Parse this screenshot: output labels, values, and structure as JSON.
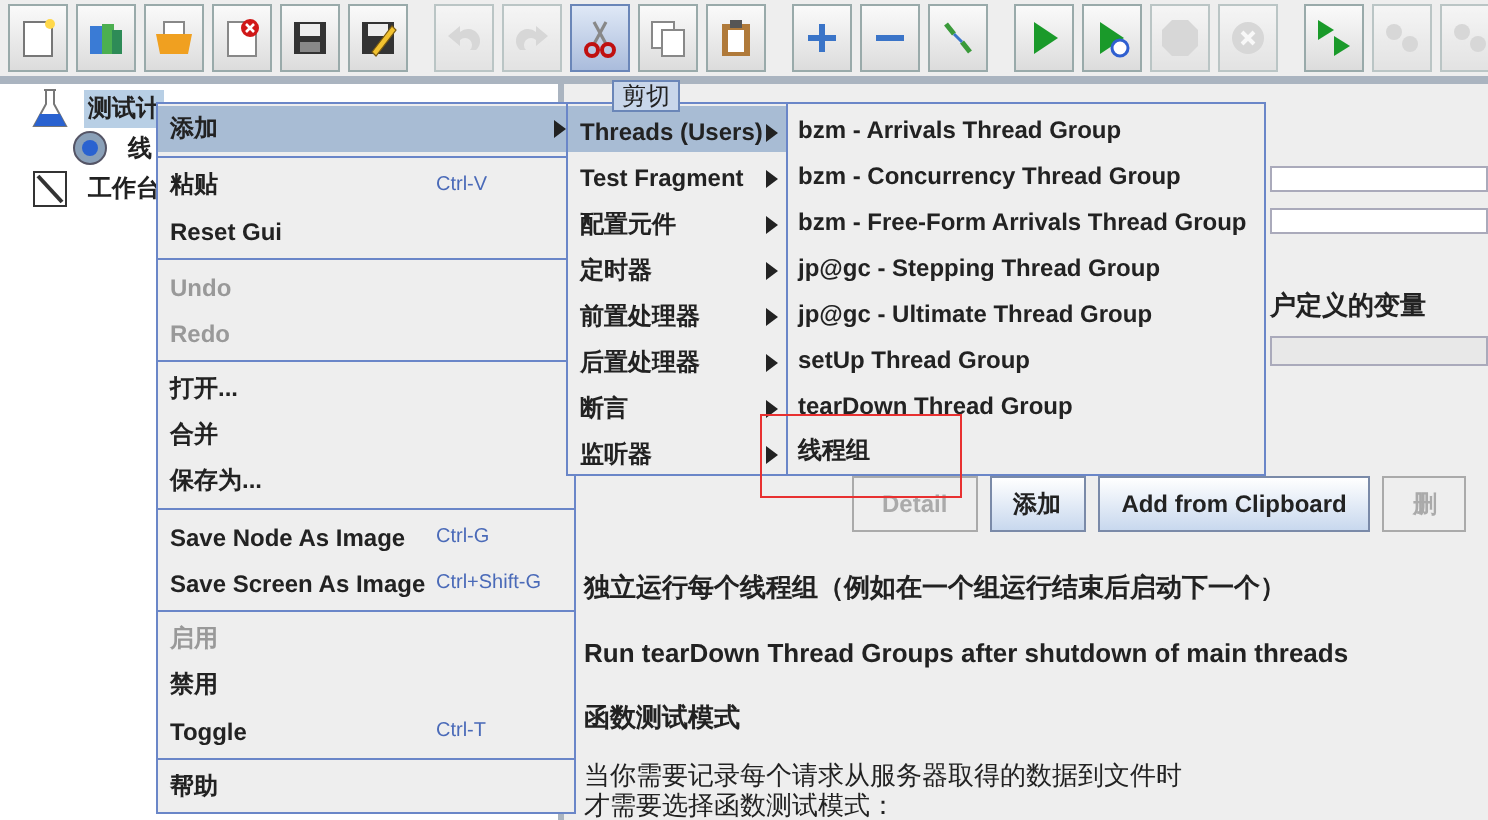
{
  "toolbar": [
    [
      {
        "kind": "new",
        "disabled": false,
        "selected": false
      },
      {
        "kind": "templates",
        "disabled": false,
        "selected": false
      },
      {
        "kind": "open",
        "disabled": false,
        "selected": false
      },
      {
        "kind": "close",
        "disabled": false,
        "selected": false
      },
      {
        "kind": "save",
        "disabled": false,
        "selected": false
      },
      {
        "kind": "save-as",
        "disabled": false,
        "selected": false
      }
    ],
    [
      {
        "kind": "undo",
        "disabled": true,
        "selected": false
      },
      {
        "kind": "redo",
        "disabled": true,
        "selected": false
      },
      {
        "kind": "cut",
        "disabled": false,
        "selected": true
      },
      {
        "kind": "copy",
        "disabled": false,
        "selected": false
      },
      {
        "kind": "paste",
        "disabled": false,
        "selected": false
      }
    ],
    [
      {
        "kind": "expand",
        "disabled": false,
        "selected": false
      },
      {
        "kind": "collapse",
        "disabled": false,
        "selected": false
      },
      {
        "kind": "toggle",
        "disabled": false,
        "selected": false
      }
    ],
    [
      {
        "kind": "start",
        "disabled": false,
        "selected": false
      },
      {
        "kind": "start-no-pause",
        "disabled": false,
        "selected": false
      },
      {
        "kind": "stop",
        "disabled": true,
        "selected": false
      },
      {
        "kind": "shutdown",
        "disabled": true,
        "selected": false
      }
    ],
    [
      {
        "kind": "remote-start",
        "disabled": false,
        "selected": false
      },
      {
        "kind": "remote-start-all",
        "disabled": true,
        "selected": false
      },
      {
        "kind": "remote-stop",
        "disabled": true,
        "selected": false
      }
    ]
  ],
  "tooltip": "剪切",
  "tree": [
    {
      "label": "测试计",
      "selected": true,
      "kind": "plan",
      "children": [
        {
          "label": "线",
          "selected": false,
          "kind": "thread"
        }
      ]
    },
    {
      "label": "工作台",
      "selected": false,
      "kind": "workbench"
    }
  ],
  "right_panel": {
    "label": "户定义的变量",
    "buttons": [
      {
        "label": "Detail",
        "disabled": true
      },
      {
        "label": "添加",
        "disabled": false
      },
      {
        "label": "Add from Clipboard",
        "disabled": false
      },
      {
        "label": "删",
        "disabled": true
      }
    ],
    "options": [
      "独立运行每个线程组（例如在一个组运行结束后启动下一个）",
      "Run tearDown Thread Groups after shutdown of main threads",
      "函数测试模式"
    ],
    "note_lines": [
      "当你需要记录每个请求从服务器取得的数据到文件时",
      "才需要选择函数测试模式："
    ]
  },
  "context_menu": [
    [
      {
        "label": "添加",
        "disabled": false,
        "selected": true,
        "submenu": true
      }
    ],
    [
      {
        "label": "粘贴",
        "shortcut": "Ctrl-V",
        "disabled": false,
        "selected": false,
        "submenu": false
      },
      {
        "label": "Reset Gui",
        "disabled": false,
        "selected": false,
        "submenu": false
      }
    ],
    [
      {
        "label": "Undo",
        "disabled": true,
        "selected": false,
        "submenu": false
      },
      {
        "label": "Redo",
        "disabled": true,
        "selected": false,
        "submenu": false
      }
    ],
    [
      {
        "label": "打开...",
        "disabled": false,
        "selected": false,
        "submenu": false
      },
      {
        "label": "合并",
        "disabled": false,
        "selected": false,
        "submenu": false
      },
      {
        "label": "保存为...",
        "disabled": false,
        "selected": false,
        "submenu": false
      }
    ],
    [
      {
        "label": "Save Node As Image",
        "shortcut": "Ctrl-G",
        "disabled": false,
        "selected": false,
        "submenu": false
      },
      {
        "label": "Save Screen As Image",
        "shortcut": "Ctrl+Shift-G",
        "disabled": false,
        "selected": false,
        "submenu": false
      }
    ],
    [
      {
        "label": "启用",
        "disabled": true,
        "selected": false,
        "submenu": false
      },
      {
        "label": "禁用",
        "disabled": false,
        "selected": false,
        "submenu": false
      },
      {
        "label": "Toggle",
        "shortcut": "Ctrl-T",
        "disabled": false,
        "selected": false,
        "submenu": false
      }
    ],
    [
      {
        "label": "帮助",
        "disabled": false,
        "selected": false,
        "submenu": false
      }
    ]
  ],
  "add_submenu": [
    {
      "label": "Threads (Users)",
      "selected": true,
      "submenu": true
    },
    {
      "label": "Test Fragment",
      "selected": false,
      "submenu": true
    },
    {
      "label": "配置元件",
      "selected": false,
      "submenu": true
    },
    {
      "label": "定时器",
      "selected": false,
      "submenu": true
    },
    {
      "label": "前置处理器",
      "selected": false,
      "submenu": true
    },
    {
      "label": "后置处理器",
      "selected": false,
      "submenu": true
    },
    {
      "label": "断言",
      "selected": false,
      "submenu": true
    },
    {
      "label": "监听器",
      "selected": false,
      "submenu": true
    }
  ],
  "threads_submenu": [
    {
      "label": "bzm - Arrivals Thread Group",
      "selected": false,
      "highlighted": false
    },
    {
      "label": "bzm - Concurrency Thread Group",
      "selected": false,
      "highlighted": false
    },
    {
      "label": "bzm - Free-Form Arrivals Thread Group",
      "selected": false,
      "highlighted": false
    },
    {
      "label": "jp@gc - Stepping Thread Group",
      "selected": false,
      "highlighted": false
    },
    {
      "label": "jp@gc - Ultimate Thread Group",
      "selected": false,
      "highlighted": false
    },
    {
      "label": "setUp Thread Group",
      "selected": false,
      "highlighted": false
    },
    {
      "label": "tearDown Thread Group",
      "selected": false,
      "highlighted": false
    },
    {
      "label": "线程组",
      "selected": false,
      "highlighted": true
    }
  ]
}
